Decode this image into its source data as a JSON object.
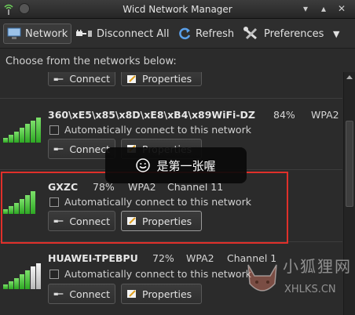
{
  "window": {
    "title": "Wicd Network Manager"
  },
  "toolbar": {
    "network_label": "Network",
    "disconnect_label": "Disconnect All",
    "refresh_label": "Refresh",
    "preferences_label": "Preferences"
  },
  "heading": "Choose from the networks below:",
  "common": {
    "connect_label": "Connect",
    "properties_label": "Properties",
    "auto_label": "Automatically connect to this network"
  },
  "networks": [
    {
      "name": "",
      "quality": "",
      "encryption": "",
      "channel": ""
    },
    {
      "name": "360\\xE5\\x85\\x8D\\xE8\\xB4\\x89WiFi-DZ",
      "quality": "84%",
      "encryption": "WPA2",
      "channel": "",
      "signal": 0.84
    },
    {
      "name": "GXZC",
      "quality": "78%",
      "encryption": "WPA2",
      "channel": "Channel 11",
      "signal": 0.78
    },
    {
      "name": "HUAWEI-TPEBPU",
      "quality": "72%",
      "encryption": "WPA2",
      "channel": "Channel 1",
      "signal": 0.72
    }
  ],
  "toast": {
    "text": "是第一张喔"
  },
  "watermark": {
    "text": "小狐狸网",
    "url": "XHLKS.CN"
  },
  "colors": {
    "highlight": "#e0302a",
    "signal_green": "#4fc43a"
  }
}
